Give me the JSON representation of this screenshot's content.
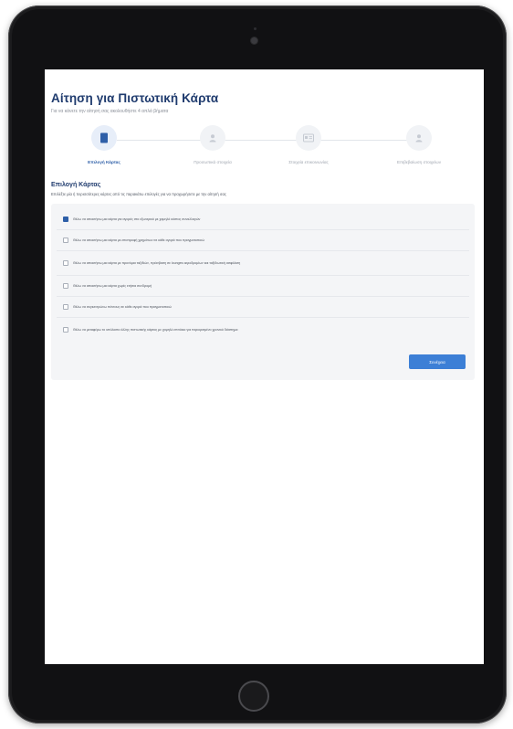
{
  "header": {
    "title": "Αίτηση για Πιστωτική Κάρτα",
    "subtitle": "Για να κάνετε την αίτησή σας ακολουθήστε 4 απλά βήματα"
  },
  "stepper": {
    "steps": [
      {
        "label": "Επιλογή Κάρτας",
        "icon": "card-icon",
        "active": true
      },
      {
        "label": "Προσωπικά στοιχεία",
        "icon": "user-icon",
        "active": false
      },
      {
        "label": "Στοιχεία επικοινωνίας",
        "icon": "contact-card-icon",
        "active": false
      },
      {
        "label": "Επιβεβαίωση στοιχείων",
        "icon": "user-check-icon",
        "active": false
      }
    ]
  },
  "section": {
    "title": "Επιλογή Κάρτας",
    "description": "Επιλέξτε μία ή περισσότερες κάρτες από τις παρακάτω επιλογές για να προχωρήσετε με την αίτησή σας"
  },
  "options": [
    {
      "label": "Θέλω να αποκτήσω μια κάρτα για αγορές στο εξωτερικό με χαμηλό κόστος συναλλαγών",
      "checked": true
    },
    {
      "label": "Θέλω να αποκτήσω μια κάρτα με επιστροφή χρημάτων σε κάθε αγορά που πραγματοποιώ",
      "checked": false
    },
    {
      "label": "Θέλω να αποκτήσω μια κάρτα με προνόμια ταξιδιών, πρόσβαση σε lounges αεροδρομίων και ταξιδιωτική ασφάλιση",
      "checked": false
    },
    {
      "label": "Θέλω να αποκτήσω μια κάρτα χωρίς ετήσια συνδρομή",
      "checked": false
    },
    {
      "label": "Θέλω να συγκεντρώνω πόντους σε κάθε αγορά που πραγματοποιώ",
      "checked": false
    },
    {
      "label": "Θέλω να μεταφέρω το υπόλοιπο άλλης πιστωτικής κάρτας με χαμηλό επιτόκιο για περιορισμένο χρονικό διάστημα",
      "checked": false
    }
  ],
  "actions": {
    "continue_label": "Συνέχεια"
  },
  "colors": {
    "accent": "#3c7fd6",
    "title": "#1f3b6e",
    "panel": "#f4f5f7"
  }
}
